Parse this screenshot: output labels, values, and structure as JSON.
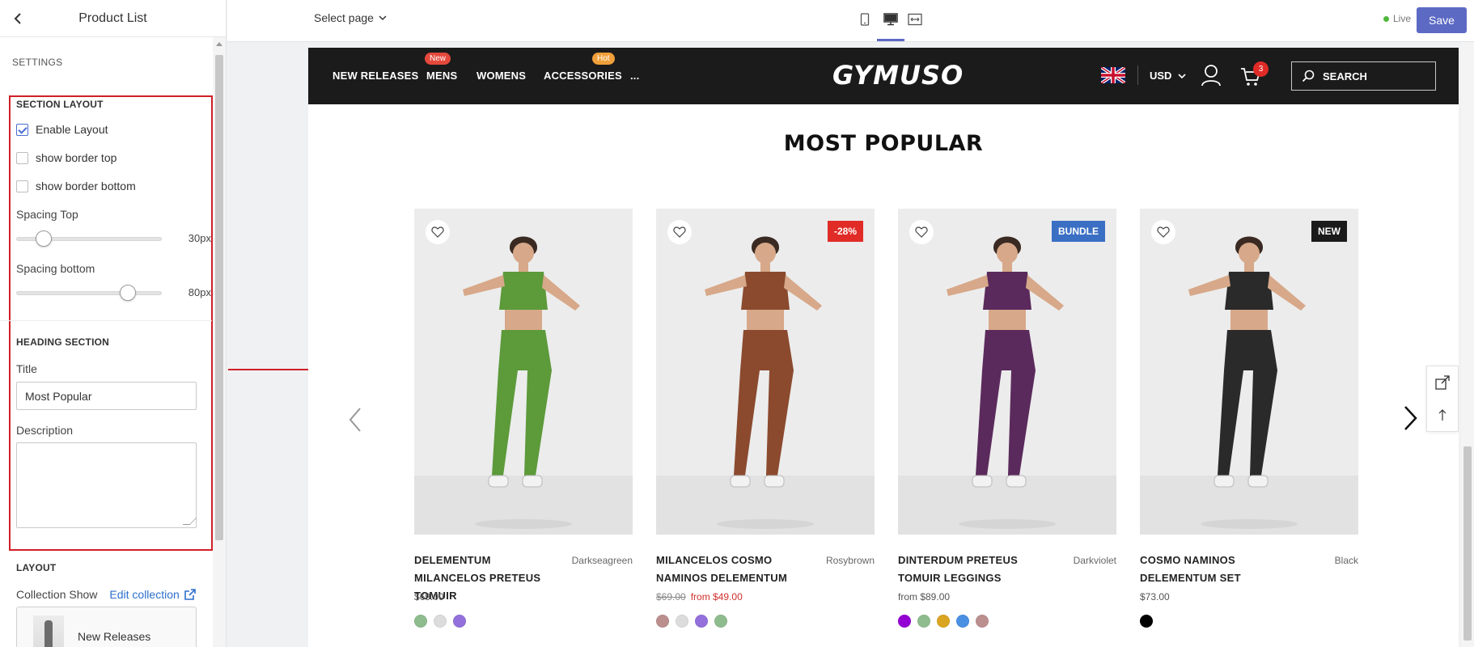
{
  "panel": {
    "title": "Product List",
    "settings_label": "SETTINGS",
    "section_layout": {
      "heading": "SECTION LAYOUT",
      "enable_layout": {
        "label": "Enable Layout",
        "checked": true
      },
      "border_top": {
        "label": "show border top",
        "checked": false
      },
      "border_bottom": {
        "label": "show border bottom",
        "checked": false
      },
      "spacing_top": {
        "label": "Spacing Top",
        "value": 30,
        "display": "30px",
        "max": 200
      },
      "spacing_bottom": {
        "label": "Spacing bottom",
        "value": 80,
        "display": "80px",
        "max": 100
      }
    },
    "heading_section": {
      "heading": "HEADING SECTION",
      "title_label": "Title",
      "title_value": "Most Popular",
      "description_label": "Description",
      "description_value": ""
    },
    "layout": {
      "heading": "LAYOUT",
      "collection_show_label": "Collection Show",
      "edit_collection_label": "Edit collection",
      "collection_name": "New Releases"
    }
  },
  "topbar": {
    "select_page": "Select page",
    "devices": [
      "mobile-icon",
      "desktop-icon",
      "fullwidth-icon"
    ],
    "active_device": "desktop-icon",
    "live_label": "Live",
    "save_label": "Save"
  },
  "store": {
    "nav": [
      {
        "label": "NEW RELEASES",
        "badge": null
      },
      {
        "label": "MENS",
        "badge": "New",
        "badge_color": "#e4493c"
      },
      {
        "label": "WOMENS",
        "badge": null
      },
      {
        "label": "ACCESSORIES",
        "badge": "Hot",
        "badge_color": "#f0a03a"
      },
      {
        "label": "...",
        "badge": null
      }
    ],
    "logo": "GYMUSO",
    "currency": "USD",
    "cart_count": "3",
    "search_label": "SEARCH"
  },
  "section": {
    "title": "MOST POPULAR",
    "products": [
      {
        "title": "DELEMENTUM MILANCELOS PRETEUS TOMUIR",
        "color": "Darkseagreen",
        "price": "$69.00",
        "old_price": "",
        "sale_price": "",
        "badge": "",
        "badge_color": "",
        "outfit": "#5c9a3a",
        "swatches": [
          "#8fbc8f",
          "#dcdcdc",
          "#9370db"
        ]
      },
      {
        "title": "MILANCELOS COSMO NAMINOS DELEMENTUM",
        "color": "Rosybrown",
        "price": "",
        "old_price": "$69.00",
        "sale_price": "from $49.00",
        "badge": "-28%",
        "badge_color": "#e02b27",
        "outfit": "#8b4a2e",
        "swatches": [
          "#bc8f8f",
          "#dcdcdc",
          "#9370db",
          "#8fbc8f"
        ]
      },
      {
        "title": "DINTERDUM PRETEUS TOMUIR LEGGINGS",
        "color": "Darkviolet",
        "price": "from $89.00",
        "old_price": "",
        "sale_price": "",
        "badge": "BUNDLE",
        "badge_color": "#3a6fc4",
        "outfit": "#5b2a5c",
        "swatches": [
          "#9400d3",
          "#8fbc8f",
          "#daa520",
          "#4a90e2",
          "#bc8f8f"
        ]
      },
      {
        "title": "COSMO NAMINOS DELEMENTUM SET",
        "color": "Black",
        "price": "$73.00",
        "old_price": "",
        "sale_price": "",
        "badge": "NEW",
        "badge_color": "#1b1b1b",
        "outfit": "#2a2a2a",
        "swatches": [
          "#000000"
        ]
      }
    ]
  }
}
